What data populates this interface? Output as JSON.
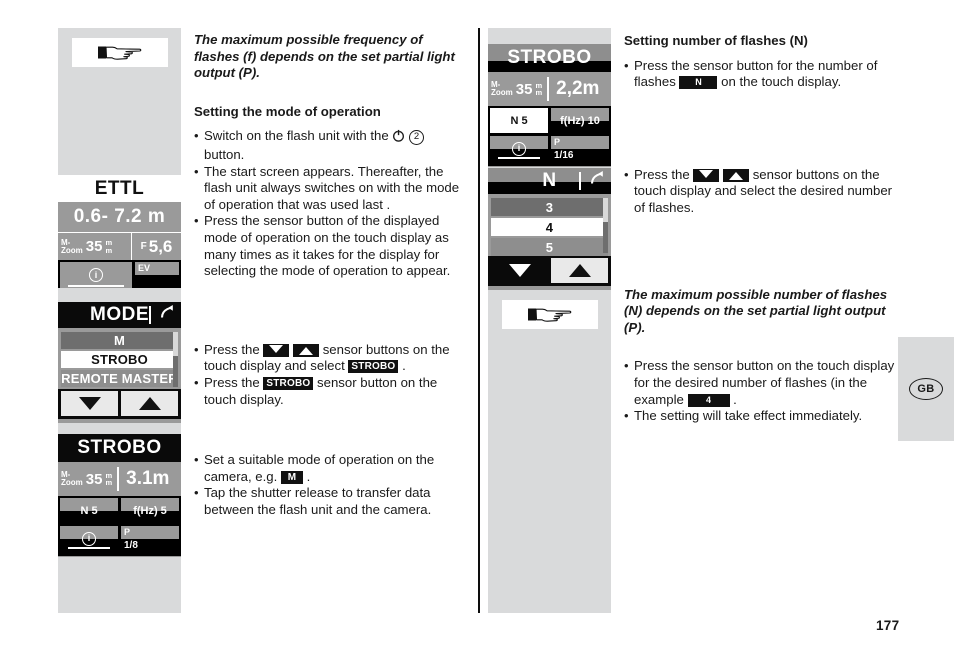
{
  "page": {
    "number": "177",
    "language_badge": "GB"
  },
  "icons": {
    "pointing_hand": "pointing-hand-icon",
    "power": "power-icon",
    "back_arrow": "back-arrow-icon",
    "info": "info-icon",
    "triangle_down": "triangle-down-icon",
    "triangle_up": "triangle-up-icon"
  },
  "colors": {
    "column_background": "#d9dadb",
    "lcd_background": "#9a9a9a",
    "lcd_dark": "#0a0a0a",
    "lcd_highlight": "#ffffff",
    "text": "#1a1a1a"
  },
  "column1": {
    "panel_ettl": {
      "title": "ETTL",
      "distance": "0.6- 7.2 m",
      "zoom_label_top": "M-",
      "zoom_label_bottom": "Zoom",
      "zoom_value": "35",
      "zoom_unit_top": "m",
      "zoom_unit_bottom": "m",
      "aperture_label": "F",
      "aperture_value": "5,6",
      "info_icon": "i",
      "ev_label": "EV"
    },
    "panel_mode": {
      "header": "MODE",
      "items": [
        {
          "label": "M",
          "state": "dim"
        },
        {
          "label": "STROBO",
          "state": "selected"
        },
        {
          "label": "REMOTE MASTER",
          "state": "mid"
        }
      ],
      "arrow_down": "triangle-down-icon",
      "arrow_up": "triangle-up-icon"
    },
    "panel_strobo": {
      "title": "STROBO",
      "zoom_label_top": "M-",
      "zoom_label_bottom": "Zoom",
      "zoom_value": "35",
      "zoom_unit_top": "m",
      "zoom_unit_bottom": "m",
      "distance": "3.1m",
      "n_label": "N 5",
      "f_label": "f(Hz) 5",
      "info_icon": "i",
      "p_label": "P",
      "p_value": "1/8"
    }
  },
  "column2": {
    "panel_strobo": {
      "title": "STROBO",
      "zoom_label_top": "M-",
      "zoom_label_bottom": "Zoom",
      "zoom_value": "35",
      "zoom_unit_top": "m",
      "zoom_unit_bottom": "m",
      "distance": "2,2m",
      "n_label": "N 5",
      "f_label": "f(Hz) 10",
      "info_icon": "i",
      "p_label": "P",
      "p_value": "1/16"
    },
    "panel_n": {
      "header": "N",
      "items": [
        {
          "label": "3",
          "state": "dim"
        },
        {
          "label": "4",
          "state": "selected"
        },
        {
          "label": "5",
          "state": "mid"
        }
      ],
      "arrow_down": "triangle-down-icon",
      "arrow_up": "triangle-up-icon"
    }
  },
  "text_left": {
    "note1": "The maximum possible frequency of flashes (f) depends on the set partial light output (P).",
    "heading1": "Setting the mode of operation",
    "b1_part1": "Switch on the flash unit with the ",
    "b1_circled": "2",
    "b1_part2": " button.",
    "b1_sub": "The start screen appears. Thereafter, the flash unit always switches on with the mode of operation that was used last .",
    "b2": "Press the sensor button of the displayed mode of operation on the touch display as many times as it takes for the display for selecting the mode of operation to appear.",
    "b3_part1": "Press the ",
    "b3_part2": " sensor buttons on the touch display and select ",
    "b3_badge": "STROBO",
    "b3_part3": " .",
    "b4_part1": "Press the ",
    "b4_badge": "STROBO",
    "b4_part2": " sensor button on the touch display.",
    "b5_part1": "Set a suitable mode of operation on the camera, e.g. ",
    "b5_badge": "M",
    "b5_part2": " .",
    "b6": "Tap the shutter release to transfer data between the flash unit and the camera."
  },
  "text_right": {
    "heading1": "Setting number of flashes (N)",
    "b1_part1": "Press the sensor button for the number of flashes ",
    "b1_badge": "N",
    "b1_part2": " on the touch display.",
    "b2_part1": "Press the ",
    "b2_part2": " sensor buttons on the touch display and select the desired number of flashes.",
    "note1": "The maximum possible number of flashes (N) depends on the set partial light output (P).",
    "b3_part1": "Press the sensor button on the touch display for the desired number of flashes (in the example ",
    "b3_badge": "4",
    "b3_part2": " .",
    "b3_sub": "The setting will take effect immediately."
  }
}
